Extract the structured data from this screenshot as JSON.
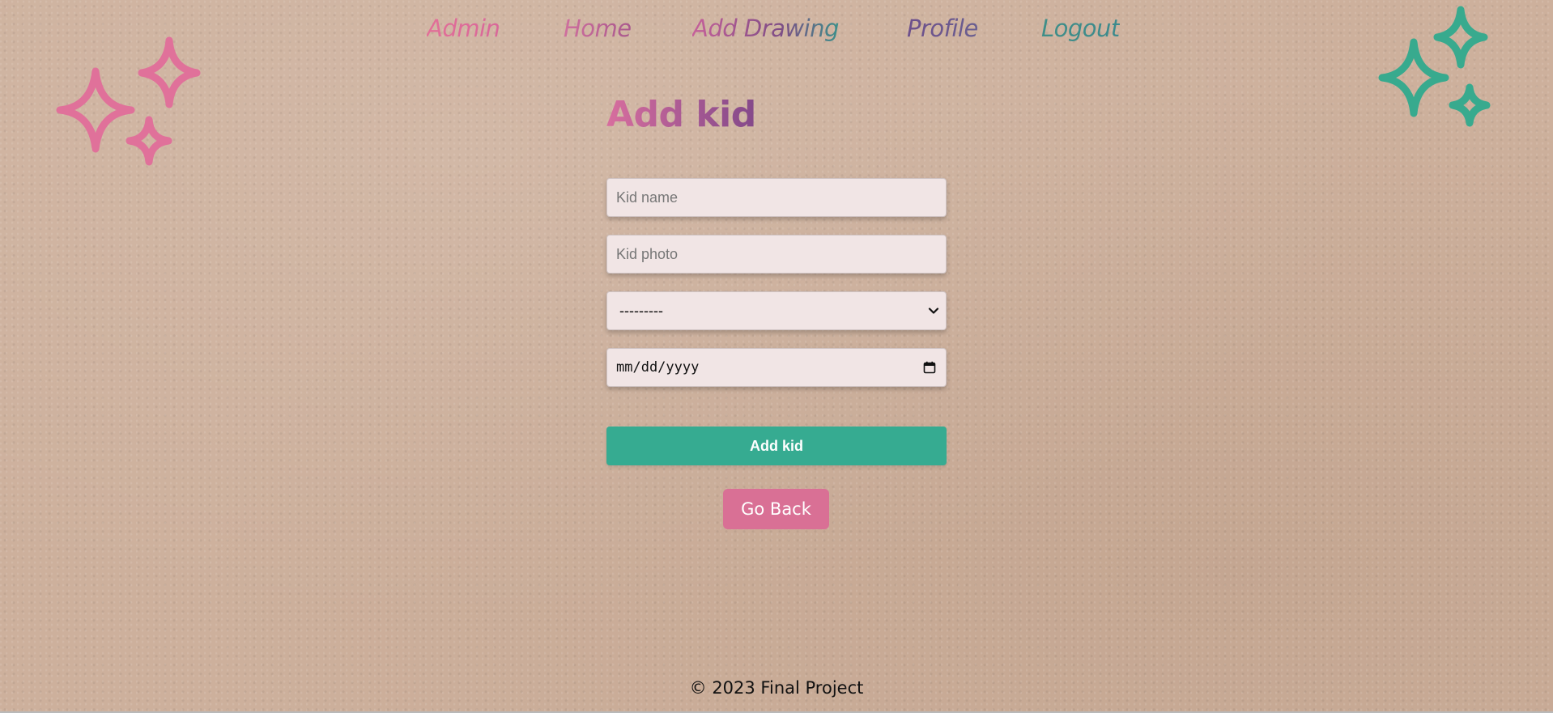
{
  "nav": {
    "items": [
      {
        "label": "Admin"
      },
      {
        "label": "Home"
      },
      {
        "label": "Add Drawing"
      },
      {
        "label": "Profile"
      },
      {
        "label": "Logout"
      }
    ]
  },
  "page": {
    "title": "Add kid"
  },
  "form": {
    "kid_name": {
      "placeholder": "Kid name",
      "value": ""
    },
    "kid_photo": {
      "placeholder": "Kid photo",
      "value": ""
    },
    "select": {
      "selected": "---------"
    },
    "date": {
      "placeholder": "mm/dd/yyyy"
    },
    "submit_label": "Add kid"
  },
  "back_label": "Go Back",
  "footer": {
    "text": "© 2023 Final Project"
  },
  "colors": {
    "pink": "#e26f98",
    "teal": "#36ab91",
    "purple": "#7e4c86",
    "back_button": "#d97095",
    "input_bg": "#f1e5e5"
  },
  "icons": {
    "left_decoration": "sparkles-pink-icon",
    "right_decoration": "sparkles-teal-icon",
    "select_arrow": "chevron-down-icon",
    "date_picker": "calendar-icon"
  }
}
